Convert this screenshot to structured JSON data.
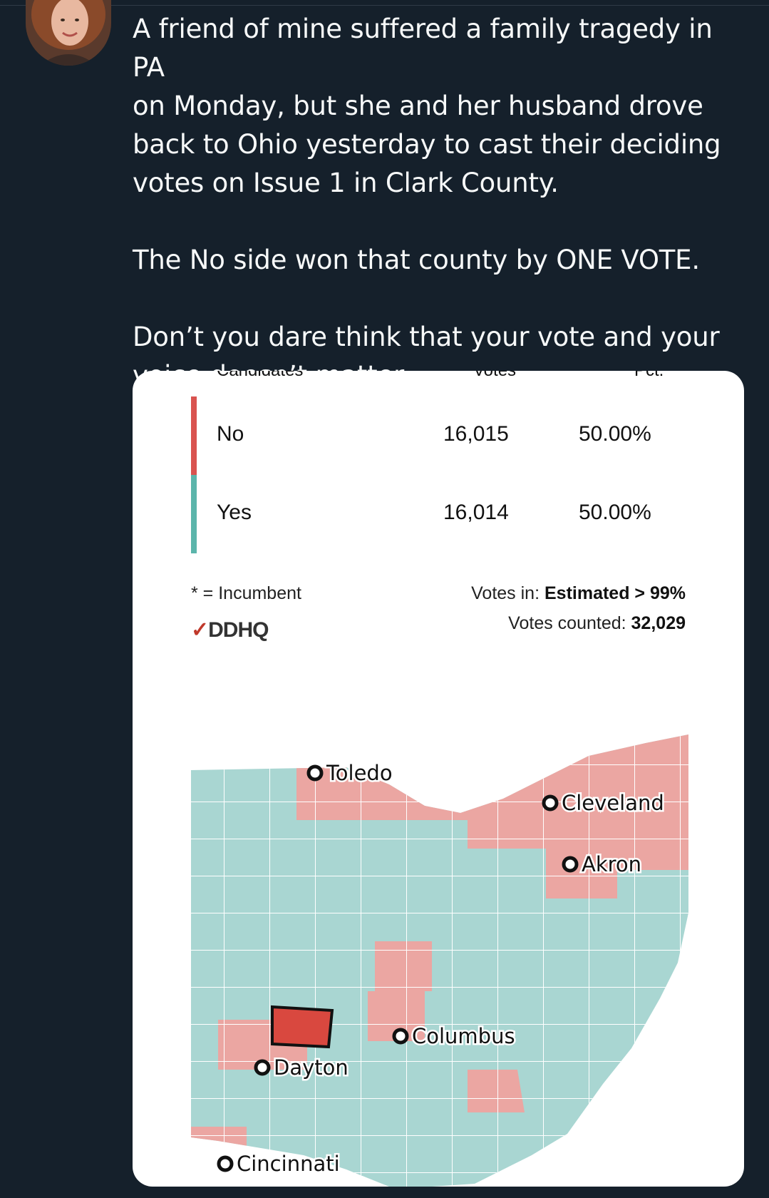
{
  "post": {
    "paragraphs": [
      "A friend of mine suffered a family tragedy in PA\non Monday, but she and her husband drove\nback to Ohio yesterday to cast their deciding\nvotes on Issue 1 in Clark County.",
      "The No side won that county by ONE VOTE.",
      "Don’t you dare think that your vote and your\nvoice doesn’t matter."
    ]
  },
  "results": {
    "headers": {
      "candidates": "Candidates",
      "votes": "Votes",
      "pct": "Pct."
    },
    "rows": [
      {
        "name": "No",
        "votes": "16,015",
        "pct": "50.00%",
        "color": "#d9534f"
      },
      {
        "name": "Yes",
        "votes": "16,014",
        "pct": "50.00%",
        "color": "#5bb5ab"
      }
    ],
    "incumbent_note": "* = Incumbent",
    "votes_in_label": "Votes in: ",
    "votes_in_value": "Estimated > 99%",
    "votes_counted_label": "Votes counted: ",
    "votes_counted_value": "32,029",
    "logo_text": "DDHQ"
  },
  "map": {
    "cities": [
      "Toledo",
      "Cleveland",
      "Akron",
      "Columbus",
      "Dayton",
      "Cincinnati"
    ],
    "colors": {
      "yes": "#a9d6d2",
      "no": "#eba6a2",
      "clark": "#d9483f",
      "border": "#ffffff"
    }
  }
}
